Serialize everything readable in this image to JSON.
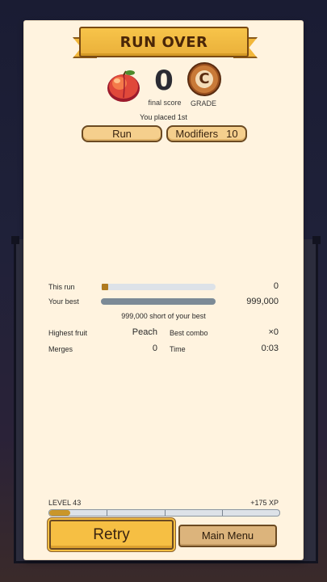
{
  "header": {
    "title": "RUN OVER"
  },
  "summary": {
    "fruit_icon": "peach-icon",
    "score": "0",
    "score_label": "final score",
    "grade": "C",
    "grade_label": "GRADE",
    "placed_text": "You placed 1st"
  },
  "tabs": {
    "run_label": "Run",
    "modifiers_label": "Modifiers",
    "modifiers_count": "10"
  },
  "comparison": {
    "this_run_label": "This run",
    "this_run_value": "0",
    "this_run_fraction": 0,
    "best_label": "Your best",
    "best_value": "999,000",
    "best_fraction": 1,
    "short_text": "999,000 short of your best"
  },
  "stats": {
    "highest_fruit_label": "Highest fruit",
    "highest_fruit_value": "Peach",
    "best_combo_label": "Best combo",
    "best_combo_value": "×0",
    "merges_label": "Merges",
    "merges_value": "0",
    "time_label": "Time",
    "time_value": "0:03"
  },
  "progress": {
    "level_text": "LEVEL 43",
    "xp_text": "+175 XP",
    "xp_fraction": 0.09
  },
  "actions": {
    "retry_label": "Retry",
    "main_menu_label": "Main Menu"
  },
  "colors": {
    "panel": "#fff3df",
    "banner": "#f2b73a",
    "retry_button": "#f6bf43",
    "secondary_button": "#dcb47c"
  }
}
